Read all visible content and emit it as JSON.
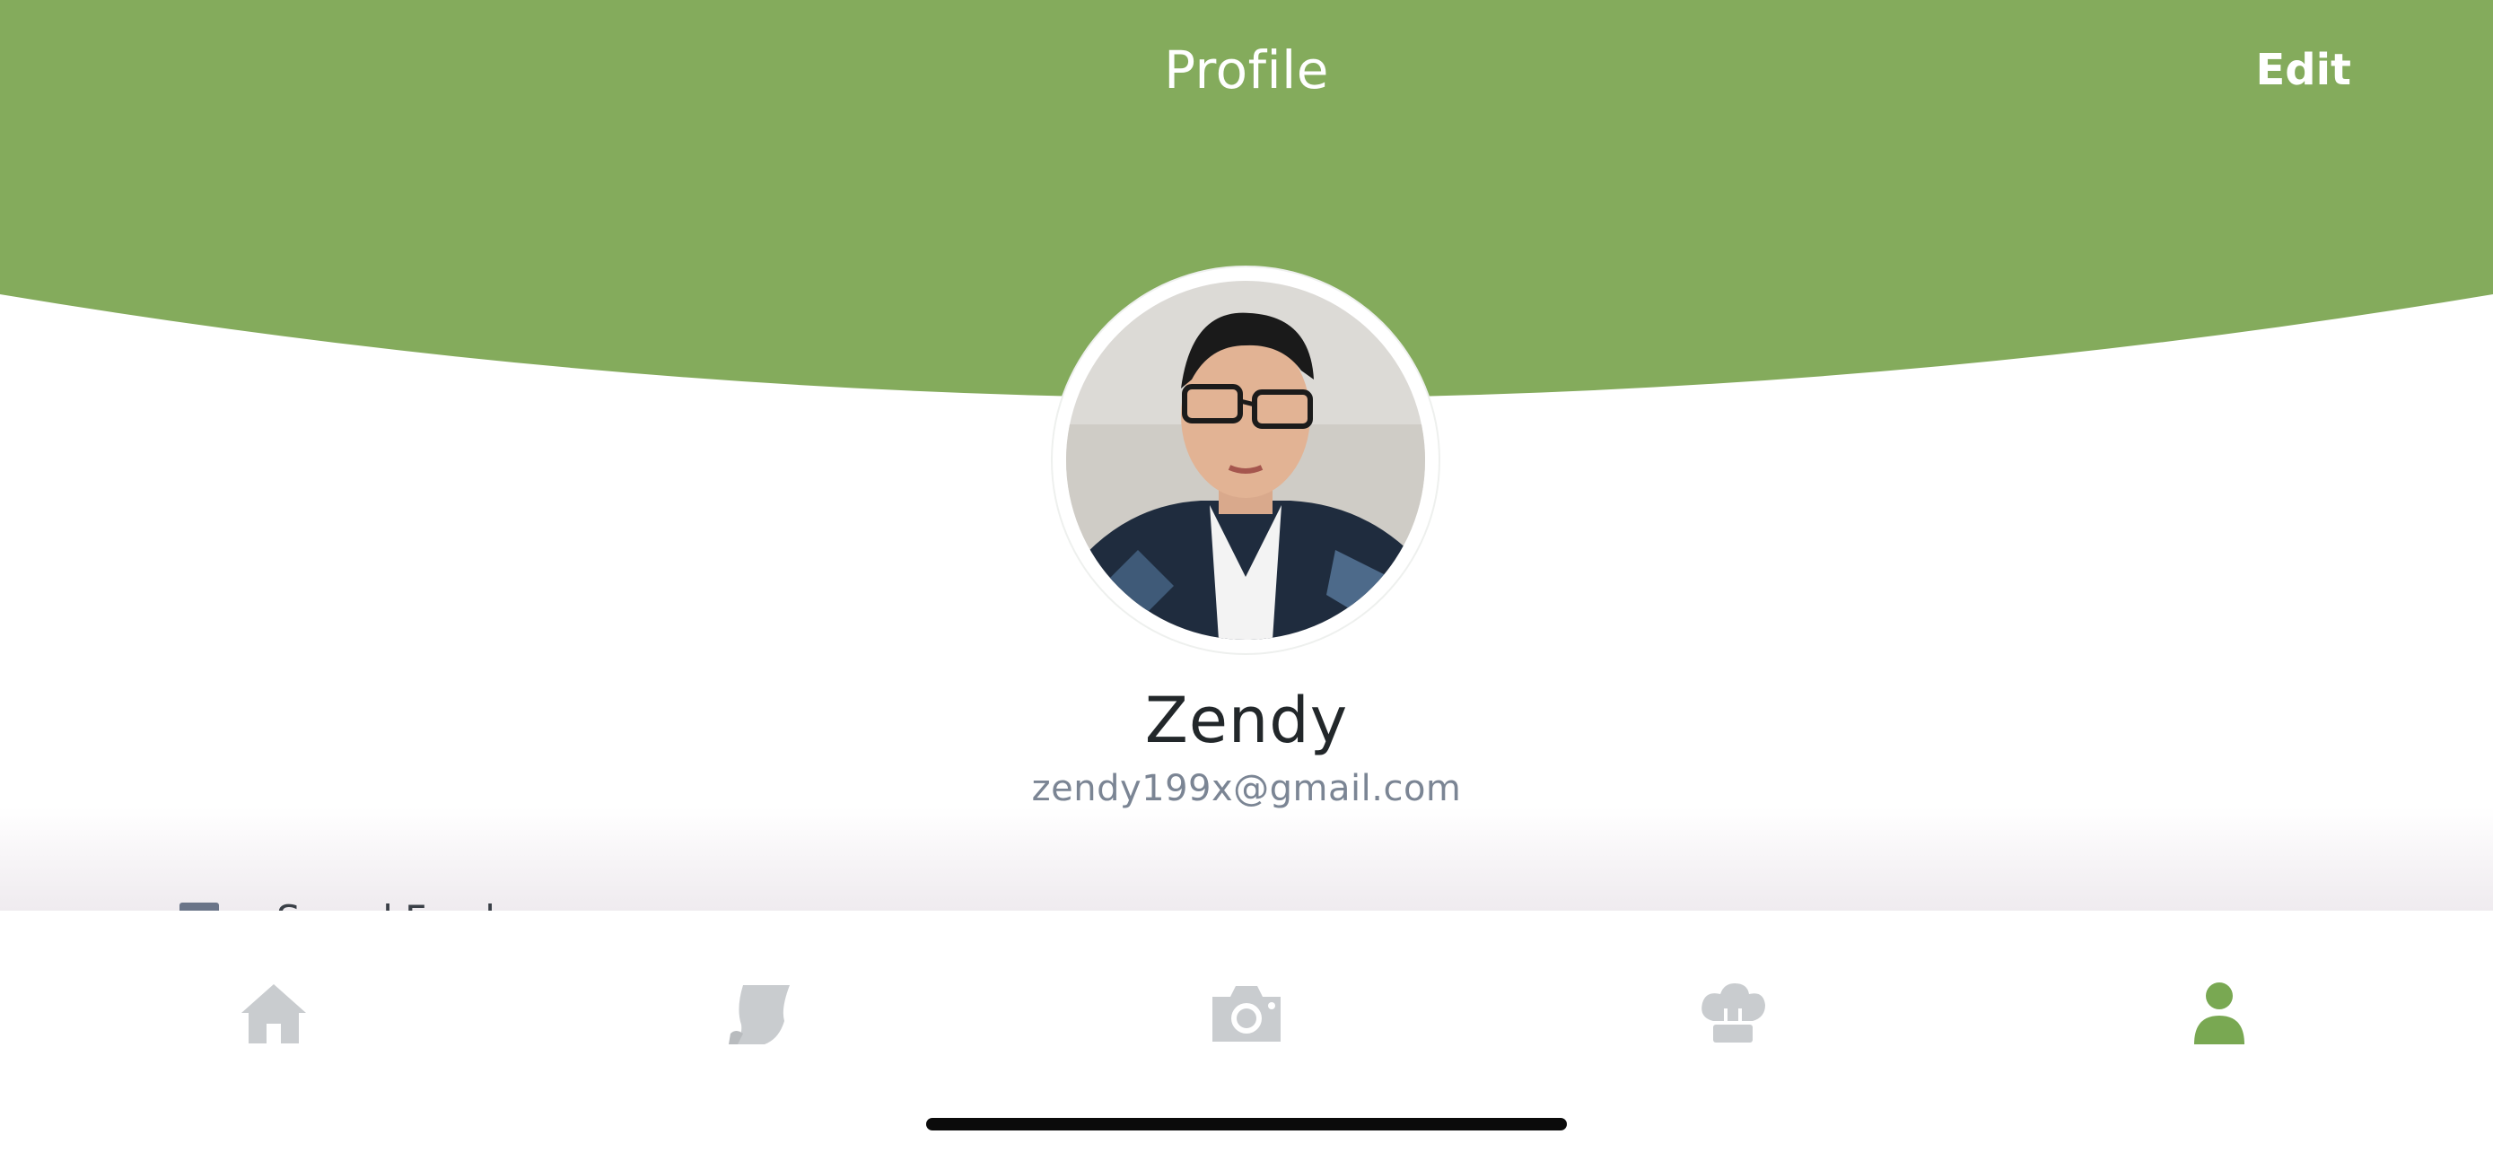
{
  "header": {
    "title": "Profile",
    "edit_label": "Edit",
    "background_color": "#84ab5c"
  },
  "user": {
    "name": "Zendy",
    "email": "zendy199x@gmail.com"
  },
  "list_preview": {
    "first_item_label": "Saved Foods"
  },
  "tab_bar": {
    "items": [
      {
        "icon": "home-icon",
        "active": false
      },
      {
        "icon": "recipe-note-icon",
        "active": false
      },
      {
        "icon": "camera-icon",
        "active": false
      },
      {
        "icon": "chef-hat-icon",
        "active": false
      },
      {
        "icon": "profile-icon",
        "active": true
      }
    ],
    "inactive_color": "#c9cccf",
    "active_color": "#79a852"
  }
}
